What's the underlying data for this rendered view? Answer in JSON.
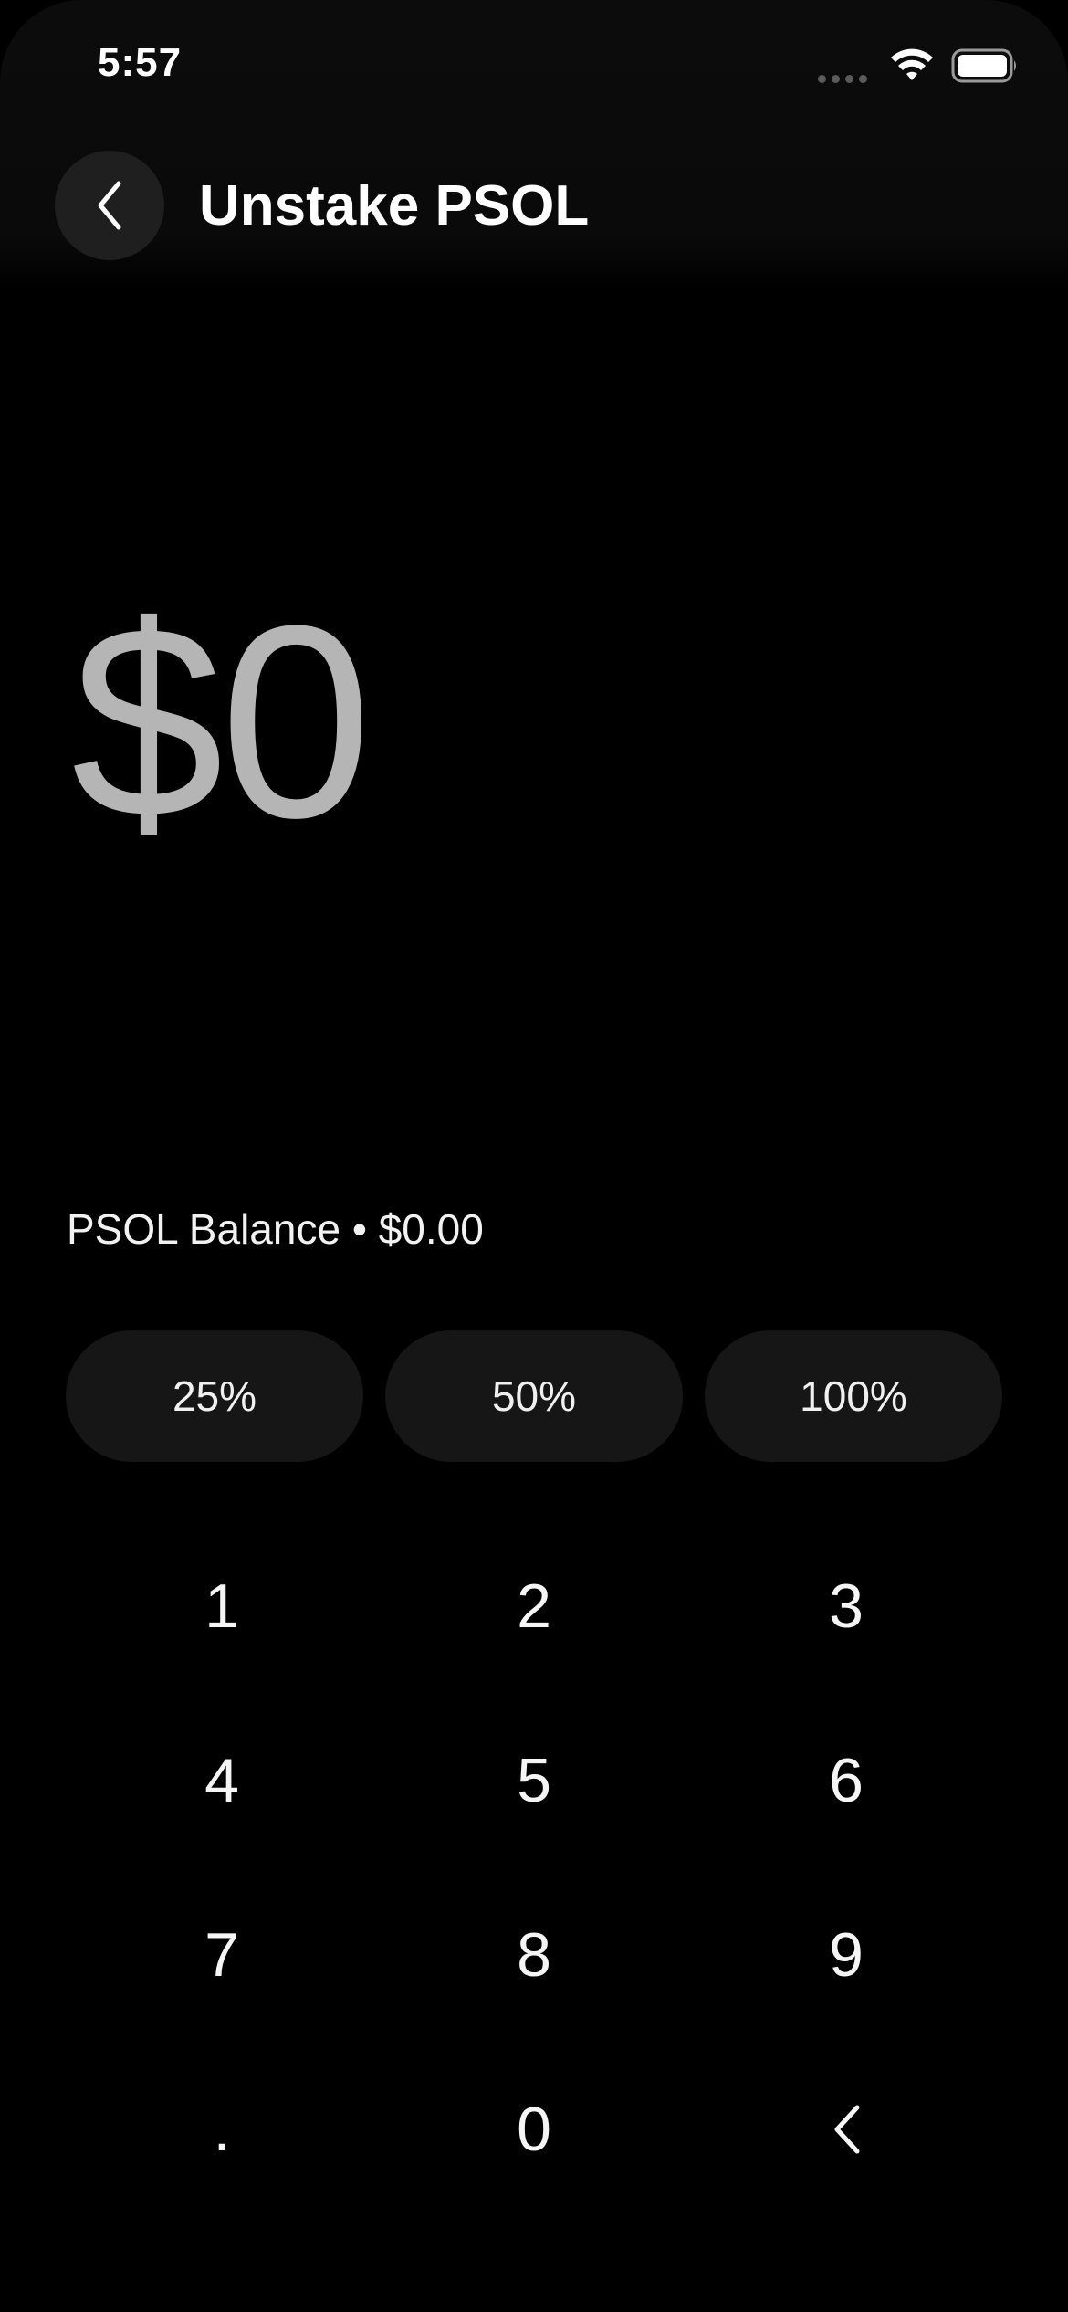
{
  "status_bar": {
    "time": "5:57",
    "icons": [
      "signal-icon",
      "wifi-icon",
      "battery-icon"
    ]
  },
  "header": {
    "back_icon": "chevron-left-icon",
    "title": "Unstake PSOL"
  },
  "amount": {
    "value": "$0"
  },
  "balance": {
    "label": "PSOL Balance • $0.00"
  },
  "percent_buttons": [
    {
      "label": "25%"
    },
    {
      "label": "50%"
    },
    {
      "label": "100%"
    }
  ],
  "keypad": {
    "keys": [
      "1",
      "2",
      "3",
      "4",
      "5",
      "6",
      "7",
      "8",
      "9",
      ".",
      "0"
    ],
    "backspace_icon": "chevron-left-icon"
  },
  "colors": {
    "background": "#000000",
    "amount_text": "#b5b5b5",
    "button_bg": "#161616",
    "back_button_bg": "#1f1f1f"
  }
}
